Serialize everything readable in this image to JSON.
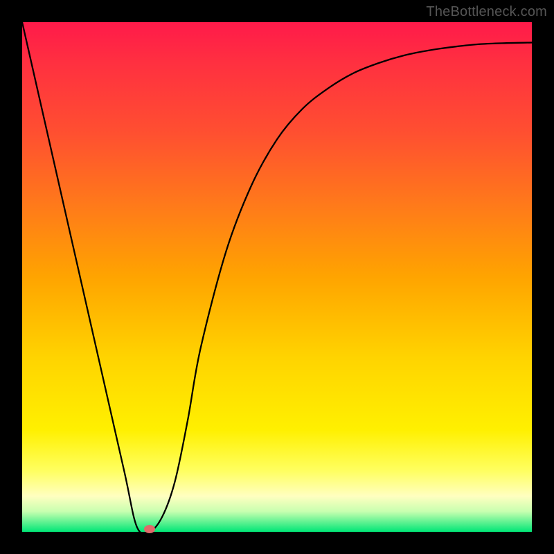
{
  "watermark": "TheBottleneck.com",
  "chart_data": {
    "type": "line",
    "title": "",
    "xlabel": "",
    "ylabel": "",
    "xlim": [
      0,
      1
    ],
    "ylim": [
      0,
      1
    ],
    "series": [
      {
        "name": "bottleneck-curve",
        "x": [
          0.0,
          0.05,
          0.1,
          0.15,
          0.2,
          0.225,
          0.25,
          0.275,
          0.3,
          0.325,
          0.35,
          0.4,
          0.45,
          0.5,
          0.55,
          0.6,
          0.65,
          0.7,
          0.75,
          0.8,
          0.85,
          0.9,
          0.95,
          1.0
        ],
        "values": [
          1.0,
          0.78,
          0.56,
          0.34,
          0.12,
          0.01,
          0.0,
          0.03,
          0.1,
          0.22,
          0.36,
          0.55,
          0.68,
          0.77,
          0.83,
          0.87,
          0.9,
          0.92,
          0.935,
          0.945,
          0.952,
          0.957,
          0.959,
          0.96
        ]
      }
    ],
    "marker": {
      "x": 0.25,
      "y": 0.0,
      "radius": 6
    },
    "background": {
      "gradient_top": "#ff1a4a",
      "gradient_bottom": "#00e676"
    }
  }
}
